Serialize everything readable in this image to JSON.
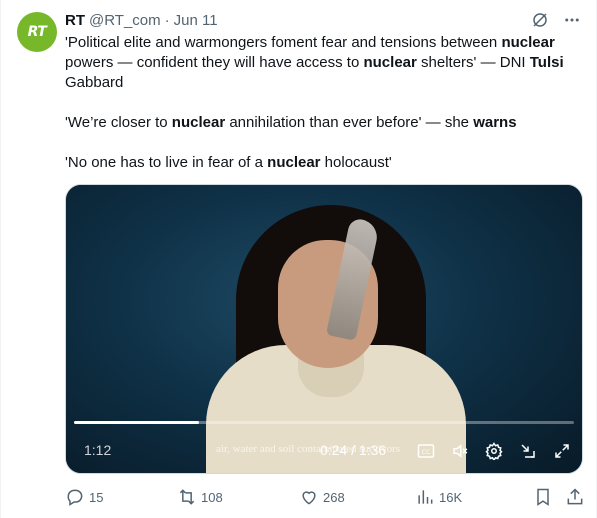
{
  "author": {
    "avatar_text": "RT",
    "name": "RT",
    "handle": "@RT_com",
    "separator": "·",
    "date": "Jun 11"
  },
  "top_icons": [
    "grok-icon",
    "more-icon"
  ],
  "body": {
    "para1": [
      {
        "t": "'Political elite and warmongers foment fear and tensions between ",
        "b": false
      },
      {
        "t": "nuclear",
        "b": true
      },
      {
        "t": " powers — confident they will have access to ",
        "b": false
      },
      {
        "t": "nuclear",
        "b": true
      },
      {
        "t": " shelters' — DNI ",
        "b": false
      },
      {
        "t": "Tulsi",
        "b": true
      },
      {
        "t": " Gabbard",
        "b": false
      }
    ],
    "para2": [
      {
        "t": "'We’re closer to ",
        "b": false
      },
      {
        "t": "nuclear",
        "b": true
      },
      {
        "t": " annihilation than ever before' — she ",
        "b": false
      },
      {
        "t": "warns",
        "b": true
      }
    ],
    "para3": [
      {
        "t": "'No one has to live in fear of a ",
        "b": false
      },
      {
        "t": "nuclear",
        "b": true
      },
      {
        "t": " holocaust'",
        "b": false
      }
    ]
  },
  "video": {
    "elapsed": "1:12",
    "time": "0:24 / 1:36",
    "caption": "air, water and soil contaminated survivors",
    "progress": 0.25,
    "controls": [
      "captions-icon",
      "mute-icon",
      "settings-icon",
      "minimize-icon",
      "fullscreen-icon"
    ]
  },
  "actions": {
    "replies": "15",
    "reposts": "108",
    "likes": "268",
    "views": "16K"
  }
}
